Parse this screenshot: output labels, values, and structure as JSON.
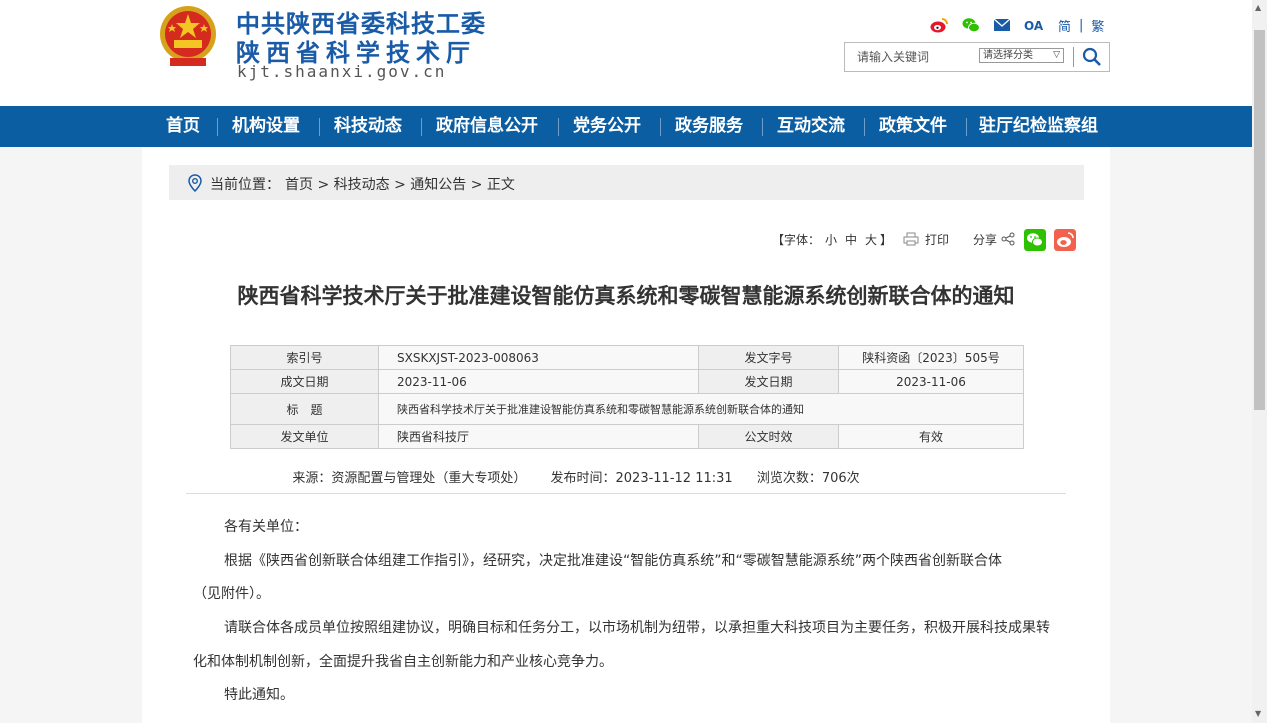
{
  "header": {
    "org_line1": "中共陕西省委科技工委",
    "org_line2": "陕西省科学技术厅",
    "domain": "kjt.shaanxi.gov.cn",
    "lang_simplified": "简",
    "lang_separator": "|",
    "lang_traditional": "繁",
    "search": {
      "placeholder": "请输入关键词",
      "category_select": "请选择分类"
    }
  },
  "nav": {
    "items": [
      "首页",
      "机构设置",
      "科技动态",
      "政府信息公开",
      "党务公开",
      "政务服务",
      "互动交流",
      "政策文件",
      "驻厅纪检监察组"
    ]
  },
  "breadcrumb": {
    "label": "当前位置：",
    "path": "首页 > 科技动态 > 通知公告 > 正文"
  },
  "tools": {
    "font_label": "【字体：",
    "font_small": "小",
    "font_medium": "中",
    "font_large": "大",
    "font_close": "】",
    "print": "打印",
    "share": "分享"
  },
  "article": {
    "title": "陕西省科学技术厅关于批准建设智能仿真系统和零碳智慧能源系统创新联合体的通知",
    "meta": {
      "index_label": "索引号",
      "index_value": "SXSKXJST-2023-008063",
      "doc_no_label": "发文字号",
      "doc_no_value": "陕科资函〔2023〕505号",
      "created_label": "成文日期",
      "created_value": "2023-11-06",
      "issued_label": "发文日期",
      "issued_value": "2023-11-06",
      "subject_label": "标　题",
      "subject_value": "陕西省科学技术厅关于批准建设智能仿真系统和零碳智慧能源系统创新联合体的通知",
      "unit_label": "发文单位",
      "unit_value": "陕西省科技厅",
      "validity_label": "公文时效",
      "validity_value": "有效"
    },
    "source": "来源：资源配置与管理处（重大专项处）",
    "publish_time": "发布时间：2023-11-12 11:31",
    "views": "浏览次数：706次",
    "body": {
      "salutation": "各有关单位：",
      "p1_line1": "根据《陕西省创新联合体组建工作指引》，经研究，决定批准建设“智能仿真系统”和“零碳智慧能源系统”两个陕西省创新联合体",
      "p1_line2": "（见附件）。",
      "p2_line1": "请联合体各成员单位按照组建协议，明确目标和任务分工，以市场机制为纽带，以承担重大科技项目为主要任务，积极开展科技成果转",
      "p2_line2": "化和体制机制创新，全面提升我省自主创新能力和产业核心竞争力。",
      "closing": "特此通知。"
    }
  },
  "icons": {
    "emblem": "national-emblem",
    "weibo": "weibo-icon",
    "wechat": "wechat-icon",
    "mail": "mail-icon",
    "oa": "OA",
    "search": "search-icon",
    "location": "location-pin-icon",
    "printer": "printer-icon",
    "share": "share-icon"
  },
  "colors": {
    "brand_blue": "#1a5ba8",
    "nav_blue": "#0c5ea3",
    "weibo_red": "#e6162d",
    "wechat_green": "#2dc100",
    "weibo_button": "#f2614d"
  }
}
